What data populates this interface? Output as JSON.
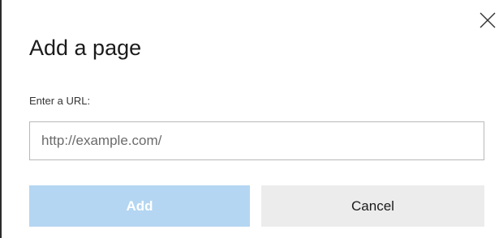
{
  "dialog": {
    "title": "Add a page",
    "url_label": "Enter a URL:",
    "url_placeholder": "http://example.com/",
    "url_value": "",
    "add_label": "Add",
    "cancel_label": "Cancel",
    "close_icon": "close-icon"
  },
  "colors": {
    "add_button_bg_disabled": "#b4d6f2",
    "add_button_text": "#ffffff",
    "cancel_button_bg": "#ececec",
    "input_border": "#b8b8b8"
  }
}
